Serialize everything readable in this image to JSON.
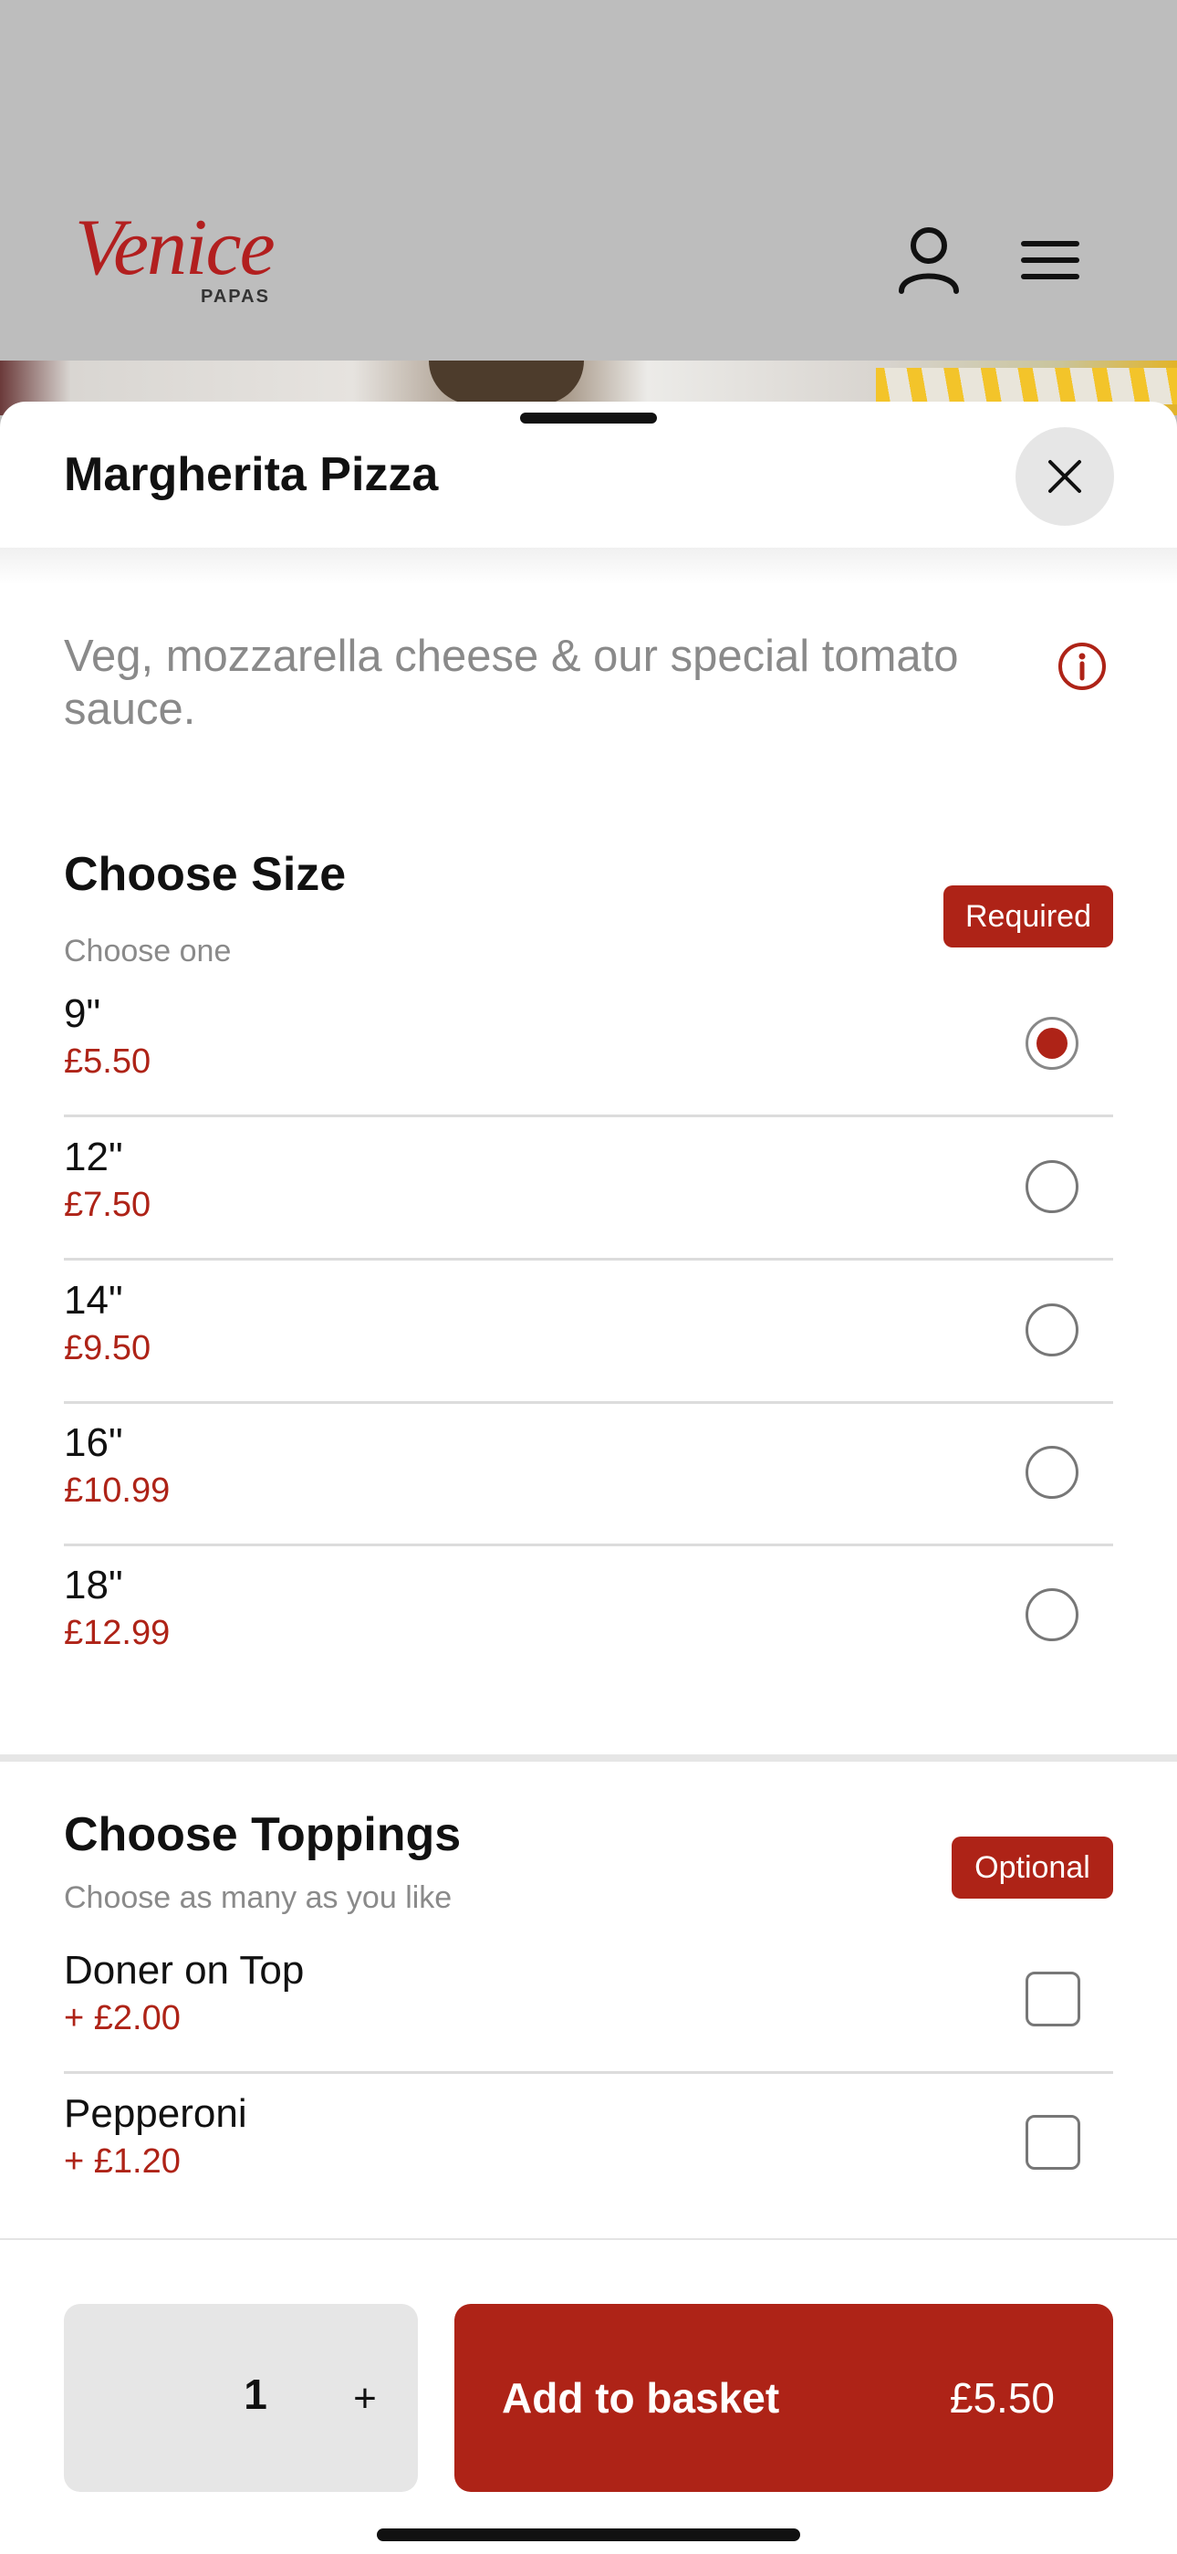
{
  "header": {
    "logo_script": "Venice",
    "logo_sub": "PAPAS",
    "user_icon": "user-icon",
    "menu_icon": "hamburger-menu-icon"
  },
  "sheet": {
    "title": "Margherita Pizza",
    "close_icon": "close-icon",
    "description": "Veg, mozzarella cheese & our special tomato sauce.",
    "info_icon": "info-icon"
  },
  "size_section": {
    "title": "Choose Size",
    "subtitle": "Choose one",
    "badge": "Required",
    "options": [
      {
        "name": "9\"",
        "price": "£5.50",
        "selected": true
      },
      {
        "name": "12\"",
        "price": "£7.50",
        "selected": false
      },
      {
        "name": "14\"",
        "price": "£9.50",
        "selected": false
      },
      {
        "name": "16\"",
        "price": "£10.99",
        "selected": false
      },
      {
        "name": "18\"",
        "price": "£12.99",
        "selected": false
      }
    ]
  },
  "toppings_section": {
    "title": "Choose Toppings",
    "subtitle": "Choose as many as you like",
    "badge": "Optional",
    "options": [
      {
        "name": "Doner on Top",
        "price": "+ £2.00",
        "checked": false
      },
      {
        "name": "Pepperoni",
        "price": "+ £1.20",
        "checked": false
      }
    ]
  },
  "footer": {
    "quantity": "1",
    "plus": "+",
    "add_label": "Add to basket",
    "add_price": "£5.50"
  },
  "colors": {
    "accent": "#ae2317",
    "header_bg": "#bdbdbd",
    "muted_text": "#8a8a8a"
  }
}
